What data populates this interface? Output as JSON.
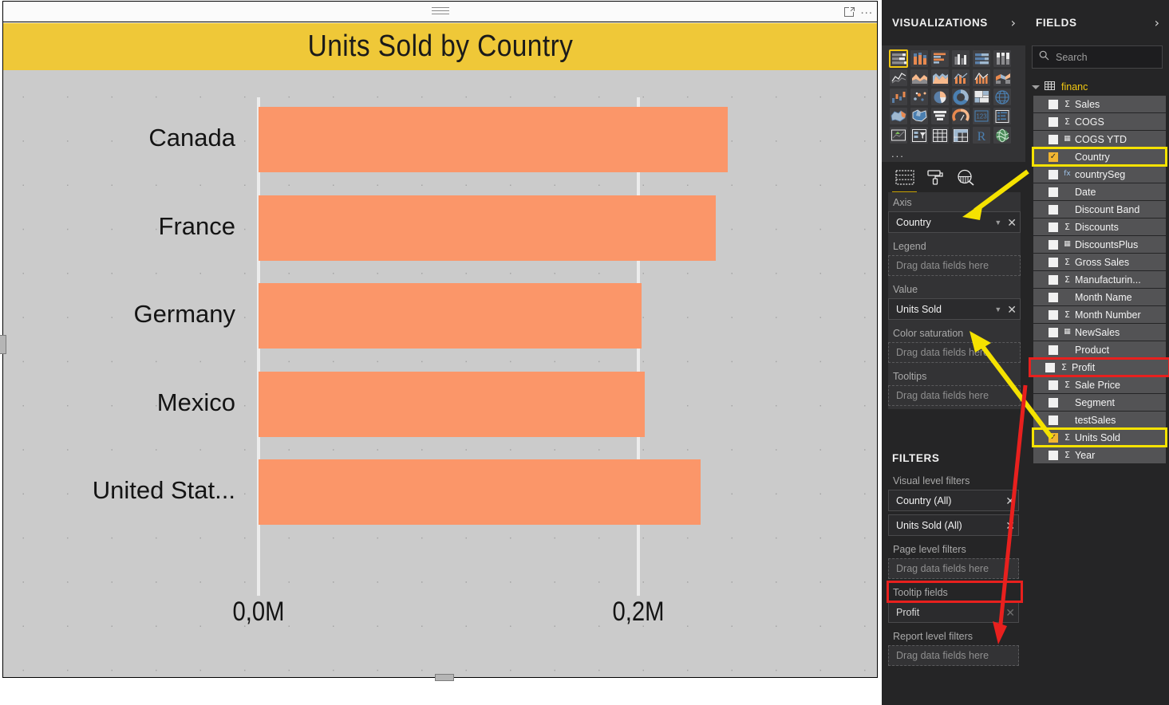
{
  "visual": {
    "title": "Units Sold by Country",
    "title_bar_color": "#efc838",
    "bar_color": "#fb9669",
    "plot_background": "#cbcbcb",
    "more_options_label": "...",
    "focus_icon": "focus-mode-icon",
    "drag_handle": "drag-grip-icon"
  },
  "chart_data": {
    "type": "bar",
    "orientation": "horizontal",
    "title": "Units Sold by Country",
    "categories": [
      "Canada",
      "France",
      "Germany",
      "Mexico",
      "United Stat..."
    ],
    "values": [
      247000,
      240700,
      201700,
      203400,
      232900
    ],
    "xlabel": "",
    "ylabel": "",
    "xlim": [
      0,
      0.25
    ],
    "xticks": [
      0,
      0.2
    ],
    "xtick_labels": [
      "0,0M",
      "0,2M"
    ],
    "grid": true,
    "legend": "none",
    "series": [
      {
        "name": "Units Sold",
        "values": [
          247000,
          240700,
          201700,
          203400,
          232900
        ]
      }
    ]
  },
  "visualizations": {
    "header": "VISUALIZATIONS",
    "expand_icon": "chevron-right-icon",
    "gallery": [
      {
        "name": "stacked-bar-chart",
        "selected": true
      },
      {
        "name": "stacked-column-chart",
        "selected": false
      },
      {
        "name": "clustered-bar-chart",
        "selected": false
      },
      {
        "name": "clustered-column-chart",
        "selected": false
      },
      {
        "name": "hundred-percent-stacked-bar-chart",
        "selected": false
      },
      {
        "name": "hundred-percent-stacked-column-chart",
        "selected": false
      },
      {
        "name": "line-chart",
        "selected": false
      },
      {
        "name": "area-chart",
        "selected": false
      },
      {
        "name": "stacked-area-chart",
        "selected": false
      },
      {
        "name": "line-and-stacked-column-chart",
        "selected": false
      },
      {
        "name": "line-and-clustered-column-chart",
        "selected": false
      },
      {
        "name": "ribbon-chart",
        "selected": false
      },
      {
        "name": "waterfall-chart",
        "selected": false
      },
      {
        "name": "scatter-chart",
        "selected": false
      },
      {
        "name": "pie-chart",
        "selected": false
      },
      {
        "name": "donut-chart",
        "selected": false
      },
      {
        "name": "treemap",
        "selected": false
      },
      {
        "name": "map",
        "selected": false
      },
      {
        "name": "filled-map",
        "selected": false
      },
      {
        "name": "shape-map",
        "selected": false
      },
      {
        "name": "funnel-chart",
        "selected": false
      },
      {
        "name": "gauge-chart",
        "selected": false
      },
      {
        "name": "card",
        "selected": false
      },
      {
        "name": "multi-row-card",
        "selected": false
      },
      {
        "name": "kpi",
        "selected": false
      },
      {
        "name": "slicer",
        "selected": false
      },
      {
        "name": "table",
        "selected": false
      },
      {
        "name": "matrix",
        "selected": false
      },
      {
        "name": "r-script-visual",
        "selected": false
      },
      {
        "name": "arcgis-maps",
        "selected": false
      }
    ],
    "more_visuals": "...",
    "tabs": [
      {
        "name": "fields-tab",
        "icon": "fields-grid-icon",
        "active": true
      },
      {
        "name": "format-tab",
        "icon": "paint-roller-icon",
        "active": false
      },
      {
        "name": "analytics-tab",
        "icon": "magnifier-chart-icon",
        "active": false
      }
    ],
    "wells": [
      {
        "label": "Axis",
        "type": "chip",
        "value": "Country"
      },
      {
        "label": "Legend",
        "type": "drop",
        "placeholder": "Drag data fields here"
      },
      {
        "label": "Value",
        "type": "chip",
        "value": "Units Sold"
      },
      {
        "label": "Color saturation",
        "type": "drop",
        "placeholder": "Drag data fields here"
      },
      {
        "label": "Tooltips",
        "type": "drop",
        "placeholder": "Drag data fields here"
      }
    ]
  },
  "filters": {
    "header": "FILTERS",
    "groups": [
      {
        "label": "Visual level filters",
        "items": [
          {
            "type": "chip",
            "value": "Country  (All)"
          },
          {
            "type": "chip",
            "value": "Units Sold  (All)"
          }
        ]
      },
      {
        "label": "Page level filters",
        "items": [
          {
            "type": "drop",
            "placeholder": "Drag data fields here"
          }
        ]
      },
      {
        "label": "Tooltip fields",
        "highlight": "red",
        "items": [
          {
            "type": "chip",
            "value": "Profit",
            "dim": true
          }
        ]
      },
      {
        "label": "Report level filters",
        "items": [
          {
            "type": "drop",
            "placeholder": "Drag data fields here"
          }
        ]
      }
    ]
  },
  "fields": {
    "header": "FIELDS",
    "expand_icon": "chevron-right-icon",
    "search_placeholder": "Search",
    "table_name": "financ",
    "items": [
      {
        "label": "Sales",
        "checked": false,
        "sigma": "sum"
      },
      {
        "label": "COGS",
        "checked": false,
        "sigma": "sum"
      },
      {
        "label": "COGS YTD",
        "checked": false,
        "sigma": "measure"
      },
      {
        "label": "Country",
        "checked": true,
        "sigma": "none",
        "highlight": "yellow"
      },
      {
        "label": "countrySeg",
        "checked": false,
        "sigma": "calc"
      },
      {
        "label": "Date",
        "checked": false,
        "sigma": "none"
      },
      {
        "label": "Discount Band",
        "checked": false,
        "sigma": "none"
      },
      {
        "label": "Discounts",
        "checked": false,
        "sigma": "sum"
      },
      {
        "label": "DiscountsPlus",
        "checked": false,
        "sigma": "measure"
      },
      {
        "label": "Gross Sales",
        "checked": false,
        "sigma": "sum"
      },
      {
        "label": "Manufacturin...",
        "checked": false,
        "sigma": "sum"
      },
      {
        "label": "Month Name",
        "checked": false,
        "sigma": "none"
      },
      {
        "label": "Month Number",
        "checked": false,
        "sigma": "sum"
      },
      {
        "label": "NewSales",
        "checked": false,
        "sigma": "measure"
      },
      {
        "label": "Product",
        "checked": false,
        "sigma": "none"
      },
      {
        "label": "Profit",
        "checked": false,
        "sigma": "sum",
        "highlight": "red"
      },
      {
        "label": "Sale Price",
        "checked": false,
        "sigma": "sum"
      },
      {
        "label": "Segment",
        "checked": false,
        "sigma": "none"
      },
      {
        "label": "testSales",
        "checked": false,
        "sigma": "none"
      },
      {
        "label": "Units Sold",
        "checked": true,
        "sigma": "sum",
        "highlight": "yellow"
      },
      {
        "label": "Year",
        "checked": false,
        "sigma": "sum"
      }
    ]
  },
  "annotations": {
    "arrows": [
      {
        "name": "country-field-to-axis-well",
        "color": "#f5e200"
      },
      {
        "name": "units-sold-field-to-value-well",
        "color": "#f5e200"
      },
      {
        "name": "profit-field-to-tooltip-fields",
        "color": "#e8201e"
      }
    ]
  }
}
